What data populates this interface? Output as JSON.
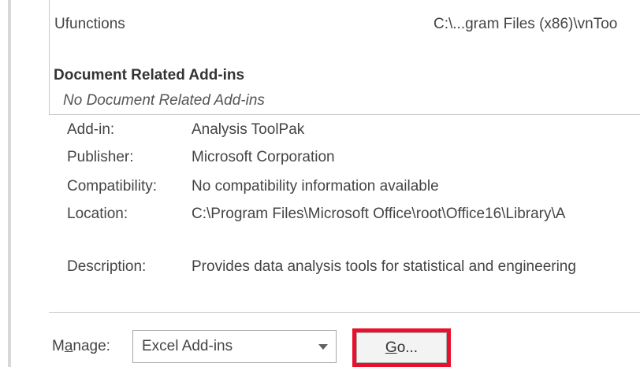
{
  "addins_list": {
    "clipped_row_text": "· · · · · · · · · · · · · · · ·",
    "ufunctions_row": {
      "name": "Ufunctions",
      "location": "C:\\...gram Files (x86)\\vnToo"
    },
    "document_related": {
      "header": "Document Related Add-ins",
      "empty_note": "No Document Related Add-ins"
    }
  },
  "details": {
    "addin_label": "Add-in:",
    "addin_value": "Analysis ToolPak",
    "publisher_label": "Publisher:",
    "publisher_value": "Microsoft Corporation",
    "compatibility_label": "Compatibility:",
    "compatibility_value": "No compatibility information available",
    "location_label": "Location:",
    "location_value": "C:\\Program Files\\Microsoft Office\\root\\Office16\\Library\\A",
    "description_label": "Description:",
    "description_value": "Provides data analysis tools for statistical and engineering"
  },
  "footer": {
    "manage_label_prefix": "M",
    "manage_label_access_key": "a",
    "manage_label_suffix": "nage:",
    "manage_selected": "Excel Add-ins",
    "go_access_key": "G",
    "go_rest": "o...",
    "highlight_color": "#e8102a"
  }
}
